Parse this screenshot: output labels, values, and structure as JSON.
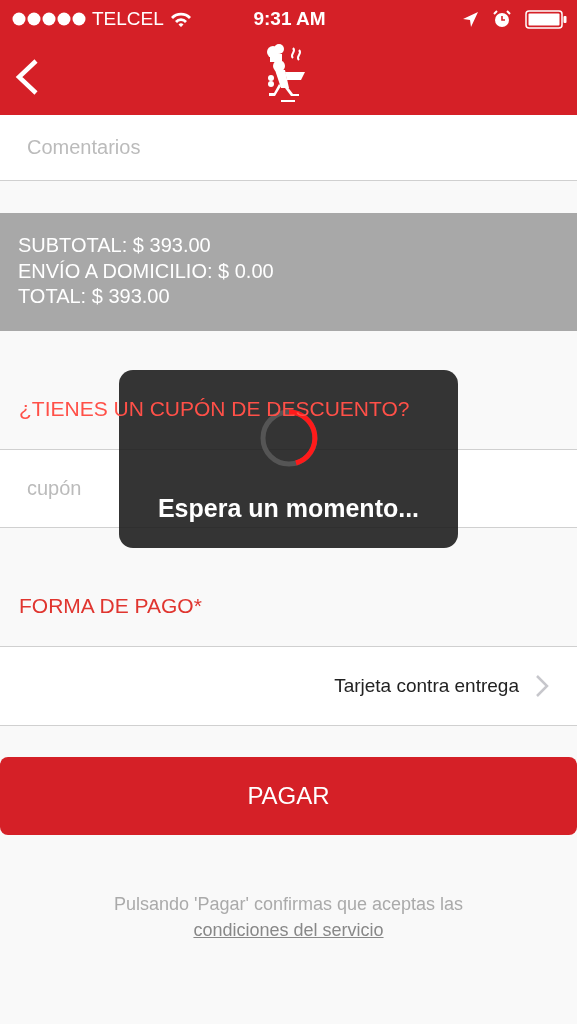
{
  "status_bar": {
    "carrier": "TELCEL",
    "time": "9:31 AM"
  },
  "comments": {
    "placeholder": "Comentarios"
  },
  "totals": [
    "SUBTOTAL: $ 393.00",
    "ENVÍO A DOMICILIO: $ 0.00",
    "TOTAL: $ 393.00"
  ],
  "coupon": {
    "heading": "¿TIENES UN CUPÓN DE DESCUENTO?",
    "placeholder": "cupón"
  },
  "payment": {
    "heading": "FORMA DE PAGO*",
    "value": "Tarjeta contra entrega"
  },
  "pay_button": "PAGAR",
  "terms": {
    "text": "Pulsando 'Pagar' confirmas que aceptas las",
    "link": "condiciones del servicio"
  },
  "loading": {
    "message": "Espera un momento..."
  }
}
